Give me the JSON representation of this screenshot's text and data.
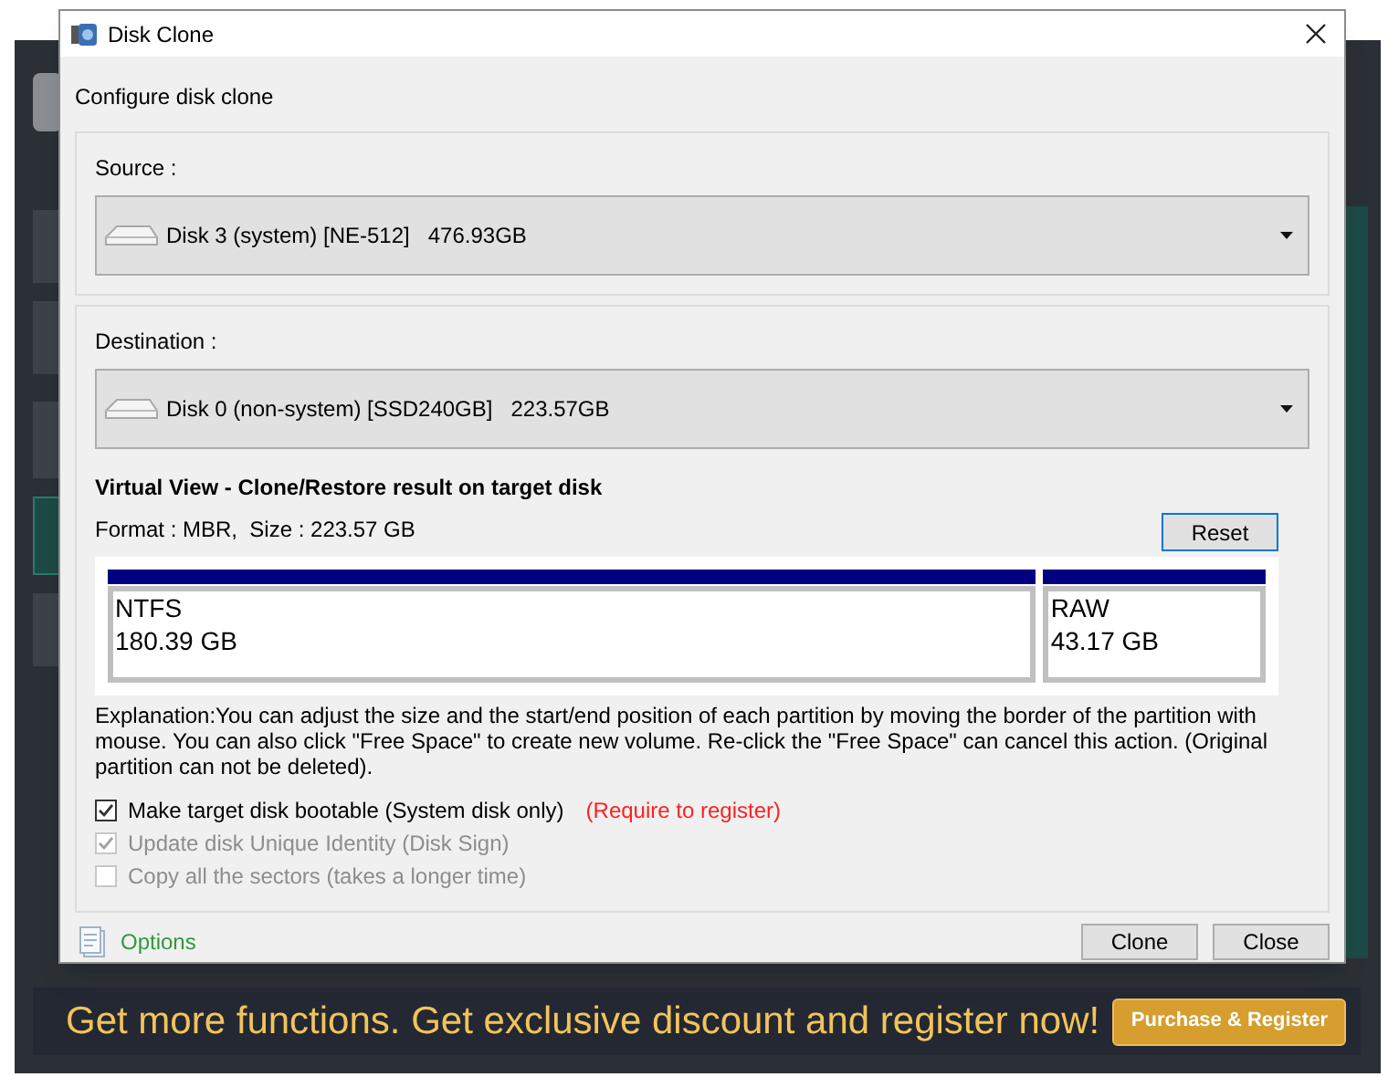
{
  "window": {
    "title": "Disk Clone"
  },
  "heading": "Configure disk clone",
  "source": {
    "label": "Source :",
    "disk": "Disk 3 (system) [NE-512]",
    "size": "476.93GB"
  },
  "destination": {
    "label": "Destination :",
    "disk": "Disk 0 (non-system) [SSD240GB]",
    "size": "223.57GB"
  },
  "virtual_view": {
    "title": "Virtual View - Clone/Restore result on target disk",
    "format": "Format : MBR,  Size : 223.57 GB",
    "reset_button": "Reset",
    "partitions": [
      {
        "fs": "NTFS",
        "size": "180.39 GB"
      },
      {
        "fs": "RAW",
        "size": "43.17 GB"
      }
    ]
  },
  "explanation": "Explanation:You can adjust the size and the start/end position of each partition by moving the border of the partition with mouse. You can also click \"Free Space\" to create new volume. Re-click the \"Free Space\" can cancel this action. (Original partition can not be deleted).",
  "options": [
    {
      "label": "Make target disk bootable (System disk only)",
      "checked": true,
      "disabled": false,
      "note": "(Require to register)"
    },
    {
      "label": "Update disk Unique Identity (Disk Sign)",
      "checked": true,
      "disabled": true
    },
    {
      "label": "Copy all the sectors (takes a longer time)",
      "checked": false,
      "disabled": true
    }
  ],
  "options_link": "Options",
  "buttons": [
    "Clone",
    "Close"
  ],
  "banner": {
    "text": "Get more functions. Get exclusive discount and register now!",
    "button": "Purchase & Register"
  }
}
